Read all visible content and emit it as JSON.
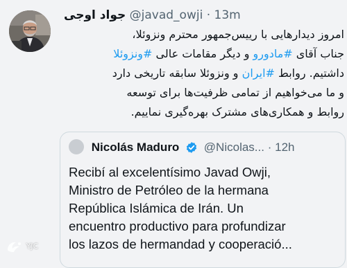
{
  "tweet": {
    "author_name": "جواد اوجی",
    "handle": "@javad_owji",
    "separator": "·",
    "time": "13m",
    "text_lines": [
      [
        {
          "t": "امروز دیدارهایی با رییس‌جمهور محترم ونزوئلا،"
        }
      ],
      [
        {
          "t": "جناب آقای "
        },
        {
          "t": "#مادورو",
          "tag": true
        },
        {
          "t": " و دیگر مقامات عالی "
        },
        {
          "t": "#ونزوئلا",
          "tag": true
        }
      ],
      [
        {
          "t": "داشتیم. روابط "
        },
        {
          "t": "#ایران",
          "tag": true
        },
        {
          "t": " و ونزوئلا سابقه تاریخی دارد"
        }
      ],
      [
        {
          "t": "و ما می‌خواهیم از تمامی ظرفیت‌ها برای توسعه"
        }
      ],
      [
        {
          "t": "روابط و همکاری‌های مشترک بهره‌گیری نماییم."
        }
      ]
    ]
  },
  "quote": {
    "author_name": "Nicolás Maduro",
    "handle": "@Nicolas...",
    "separator": "·",
    "time": "12h",
    "text_lines": [
      "Recibí al excelentísimo Javad Owji,",
      "Ministro de Petróleo de la hermana",
      "República Islámica de Irán. Un",
      "encuentro productivo para profundizar",
      "los lazos de hermandad y cooperació..."
    ]
  },
  "watermark": {
    "text": "YJC"
  },
  "colors": {
    "hashtag": "#1d9bf0",
    "secondary_text": "#536471",
    "verified": "#1d9bf0",
    "background": "#f2f3f5"
  },
  "icons": {
    "verified": "verified-badge-icon"
  }
}
